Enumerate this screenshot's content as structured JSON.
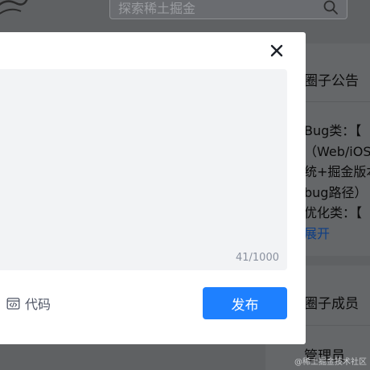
{
  "header": {
    "search_placeholder": "探索稀土掘金",
    "search_icon": "search-icon"
  },
  "modal": {
    "close_icon": "close-icon",
    "char_count": "41/1000",
    "toolbar": {
      "code_label": "代码",
      "code_icon": "code-icon"
    },
    "publish_label": "发布",
    "publish_color": "#1e80ff"
  },
  "sidebar": {
    "announcement": {
      "title": "圈子公告",
      "lines": [
        "Bug类：【",
        "（Web/iOS",
        "统+掘金版本",
        "bug路径）",
        "优化类：【"
      ],
      "expand_label": "展开"
    },
    "members": {
      "title": "圈子成员",
      "admin_label": "管理员"
    }
  },
  "watermark": "@稀土掘金技术社区"
}
